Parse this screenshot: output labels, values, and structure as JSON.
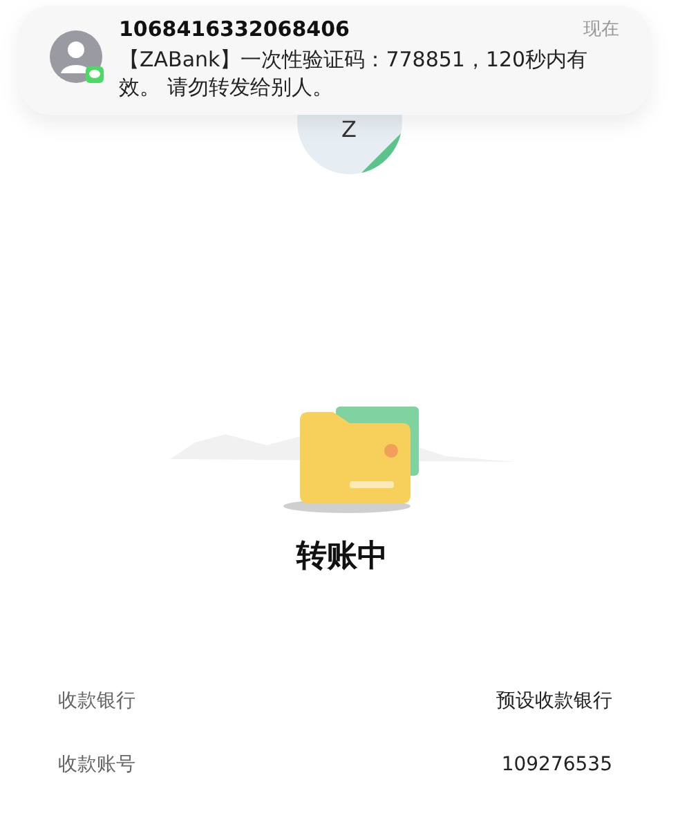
{
  "notification": {
    "sender": "1068416332068406",
    "time": "现在",
    "message": "【ZABank】一次性验证码：778851，120秒内有效。 请勿转发给别人。"
  },
  "avatar": {
    "letter": "Z"
  },
  "status": {
    "title": "转账中"
  },
  "details": [
    {
      "label": "收款银行",
      "value": "预设收款银行"
    },
    {
      "label": "收款账号",
      "value": "109276535"
    }
  ]
}
